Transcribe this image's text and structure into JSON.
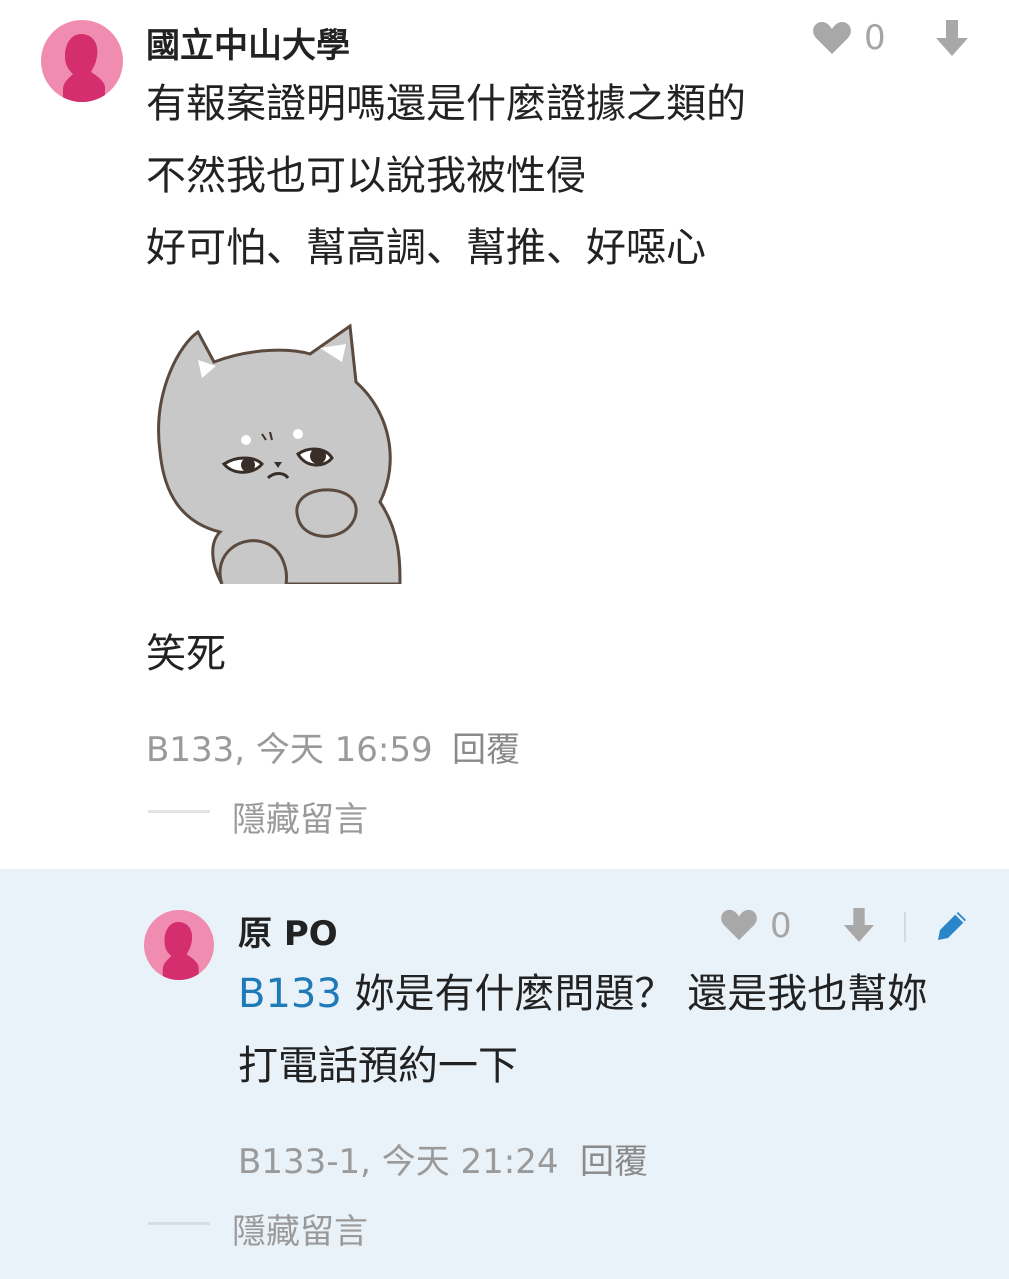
{
  "comment": {
    "author": "國立中山大學",
    "likes": "0",
    "lines": [
      "有報案證明嗎還是什麼證據之類的",
      "不然我也可以說我被性侵",
      "好可怕、幫高調、幫推、好噁心"
    ],
    "sticker_icon": "gray-cat-sticker",
    "after_sticker_text": "笑死",
    "floor_time": "B133, 今天 16:59",
    "reply_label": "回覆",
    "hide_label": "隱藏留言"
  },
  "reply": {
    "author": "原 PO",
    "likes": "0",
    "mention": "B133",
    "line1": " 妳是有什麼問題？ 還是我也幫妳",
    "line2": "打電話預約一下",
    "floor_time": "B133-1, 今天 21:24",
    "reply_label": "回覆",
    "hide_label": "隱藏留言"
  },
  "colors": {
    "avatar_bg": "#f08cb0",
    "avatar_fg": "#d42e6e",
    "mention": "#1f7ab8",
    "reply_bg": "#eaf2f9",
    "edit_icon": "#2b86c9"
  }
}
